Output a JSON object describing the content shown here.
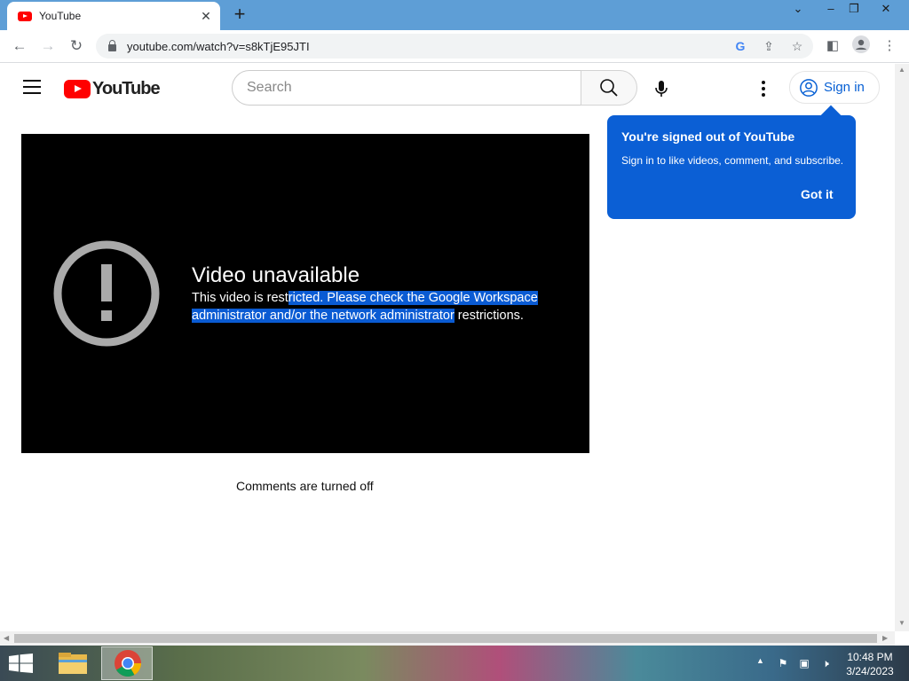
{
  "browser": {
    "tab_title": "YouTube",
    "url": "youtube.com/watch?v=s8kTjE95JTI"
  },
  "youtube": {
    "logo_text": "YouTube",
    "search_placeholder": "Search",
    "signin_label": "Sign in",
    "error_title": "Video unavailable",
    "error_msg_part1": "This video is rest",
    "error_msg_selected": "ricted. Please check the Google Workspace administrator and/or the network administrator",
    "error_msg_part3": " restrictions.",
    "comments_status": "Comments are turned off",
    "tooltip": {
      "title": "You're signed out of YouTube",
      "body": "Sign in to like videos, comment, and subscribe.",
      "button": "Got it"
    }
  },
  "taskbar": {
    "time": "10:48 PM",
    "date": "3/24/2023"
  },
  "colors": {
    "tab_strip": "#5e9ed6",
    "youtube_red": "#ff0000",
    "tooltip_blue": "#0b5fd5",
    "link_blue": "#065fd4",
    "selection_blue": "#0a5bd3"
  },
  "icons": [
    "youtube-favicon-icon",
    "close-tab-icon",
    "new-tab-icon",
    "back-icon",
    "forward-icon",
    "reload-icon",
    "lock-icon",
    "google-icon",
    "share-icon",
    "star-icon",
    "side-panel-icon",
    "profile-icon",
    "menu-icon",
    "hamburger-icon",
    "search-icon",
    "mic-icon",
    "more-icon",
    "account-icon",
    "alert-icon",
    "windows-start-icon",
    "file-explorer-icon",
    "chrome-icon"
  ]
}
